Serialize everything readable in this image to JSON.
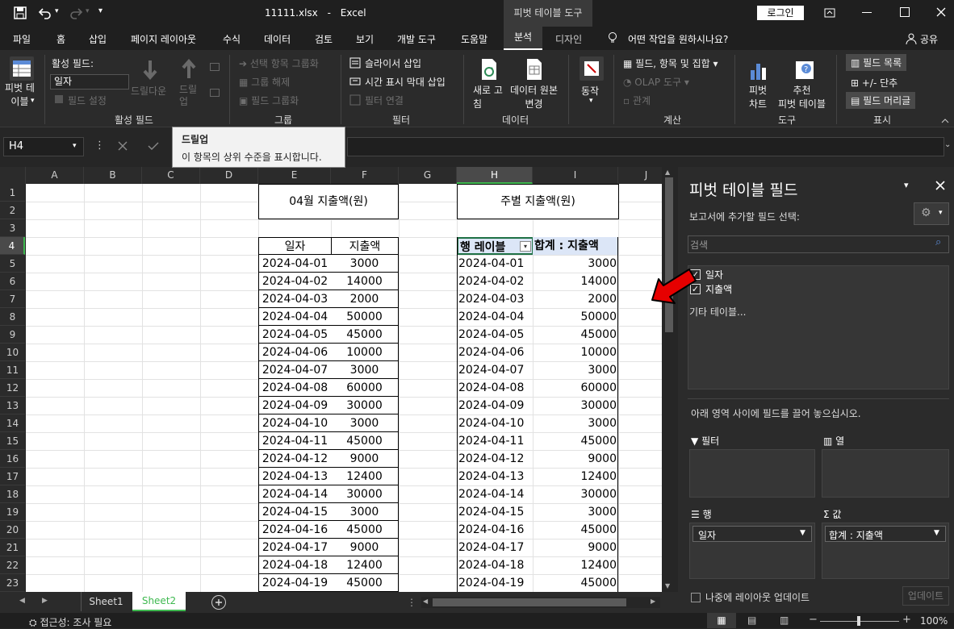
{
  "titlebar": {
    "filename": "11111.xlsx",
    "sep": "-",
    "app": "Excel",
    "context_tab": "피벗 테이블 도구",
    "login": "로그인"
  },
  "tabs": [
    "파일",
    "홈",
    "삽입",
    "페이지 레이아웃",
    "수식",
    "데이터",
    "검토",
    "보기",
    "개발 도구",
    "도움말",
    "분석",
    "디자인"
  ],
  "tell_me": "어떤 작업을 원하시나요?",
  "share": "공유",
  "ribbon": {
    "pivot_table": "피벗 테\n이블",
    "active_field_label": "활성 필드:",
    "active_field_value": "일자",
    "field_settings": "필드 설정",
    "drill_down": "드릴다운",
    "drill_up": "드릴\n업",
    "group_selection": "선택 항목 그룹화",
    "ungroup": "그룹 해제",
    "group_field": "필드 그룹화",
    "insert_slicer": "슬라이서 삽입",
    "insert_timeline": "시간 표시 막대 삽입",
    "filter_connections": "필터 연결",
    "refresh": "새로 고\n침",
    "change_source": "데이터 원본\n변경",
    "actions": "동작",
    "fields_items": "필드, 항목 및 집합",
    "olap": "OLAP 도구",
    "relationships": "관계",
    "pivot_chart": "피벗\n차트",
    "recommended": "추천\n피벗 테이블",
    "field_list": "필드 목록",
    "buttons": "+/- 단추",
    "field_headers": "필드 머리글",
    "groups": [
      "활성 필드",
      "그룹",
      "필터",
      "데이터",
      "계산",
      "도구",
      "표시"
    ]
  },
  "tooltip": {
    "title": "드릴업",
    "body": "이 항목의 상위 수준을 표시합니다."
  },
  "namebox": "H4",
  "columns": [
    "A",
    "B",
    "C",
    "D",
    "E",
    "F",
    "G",
    "H",
    "I",
    "J"
  ],
  "rows": [
    "1",
    "2",
    "3",
    "4",
    "5",
    "6",
    "7",
    "8",
    "9",
    "10",
    "11",
    "12",
    "13",
    "14",
    "15",
    "16",
    "17",
    "18",
    "19",
    "20",
    "21",
    "22",
    "23"
  ],
  "table_left": {
    "title": "04월 지출액(원)",
    "h_date": "일자",
    "h_amount": "지출액"
  },
  "table_right": {
    "title": "주별 지출액(원)",
    "h_row": "행 레이블",
    "h_sum": "합계 : 지출액"
  },
  "data": [
    [
      "2024-04-01",
      "3000"
    ],
    [
      "2024-04-02",
      "14000"
    ],
    [
      "2024-04-03",
      "2000"
    ],
    [
      "2024-04-04",
      "50000"
    ],
    [
      "2024-04-05",
      "45000"
    ],
    [
      "2024-04-06",
      "10000"
    ],
    [
      "2024-04-07",
      "3000"
    ],
    [
      "2024-04-08",
      "60000"
    ],
    [
      "2024-04-09",
      "30000"
    ],
    [
      "2024-04-10",
      "3000"
    ],
    [
      "2024-04-11",
      "45000"
    ],
    [
      "2024-04-12",
      "9000"
    ],
    [
      "2024-04-13",
      "12400"
    ],
    [
      "2024-04-14",
      "30000"
    ],
    [
      "2024-04-15",
      "3000"
    ],
    [
      "2024-04-16",
      "45000"
    ],
    [
      "2024-04-17",
      "9000"
    ],
    [
      "2024-04-18",
      "12400"
    ],
    [
      "2024-04-19",
      "45000"
    ]
  ],
  "sheets": [
    "Sheet1",
    "Sheet2"
  ],
  "pane": {
    "title": "피벗 테이블 필드",
    "subtitle": "보고서에 추가할 필드 선택:",
    "search_placeholder": "검색",
    "fields": [
      "일자",
      "지출액"
    ],
    "more_tables": "기타 테이블...",
    "drag_hint": "아래 영역 사이에 필드를 끌어 놓으십시오.",
    "areas": {
      "filter": "필터",
      "columns": "열",
      "rows": "행",
      "values": "값"
    },
    "rows_item": "일자",
    "values_item": "합계 : 지출액",
    "defer": "나중에 레이아웃 업데이트",
    "update": "업데이트"
  },
  "status": {
    "accessibility": "접근성: 조사 필요",
    "zoom": "100%"
  }
}
